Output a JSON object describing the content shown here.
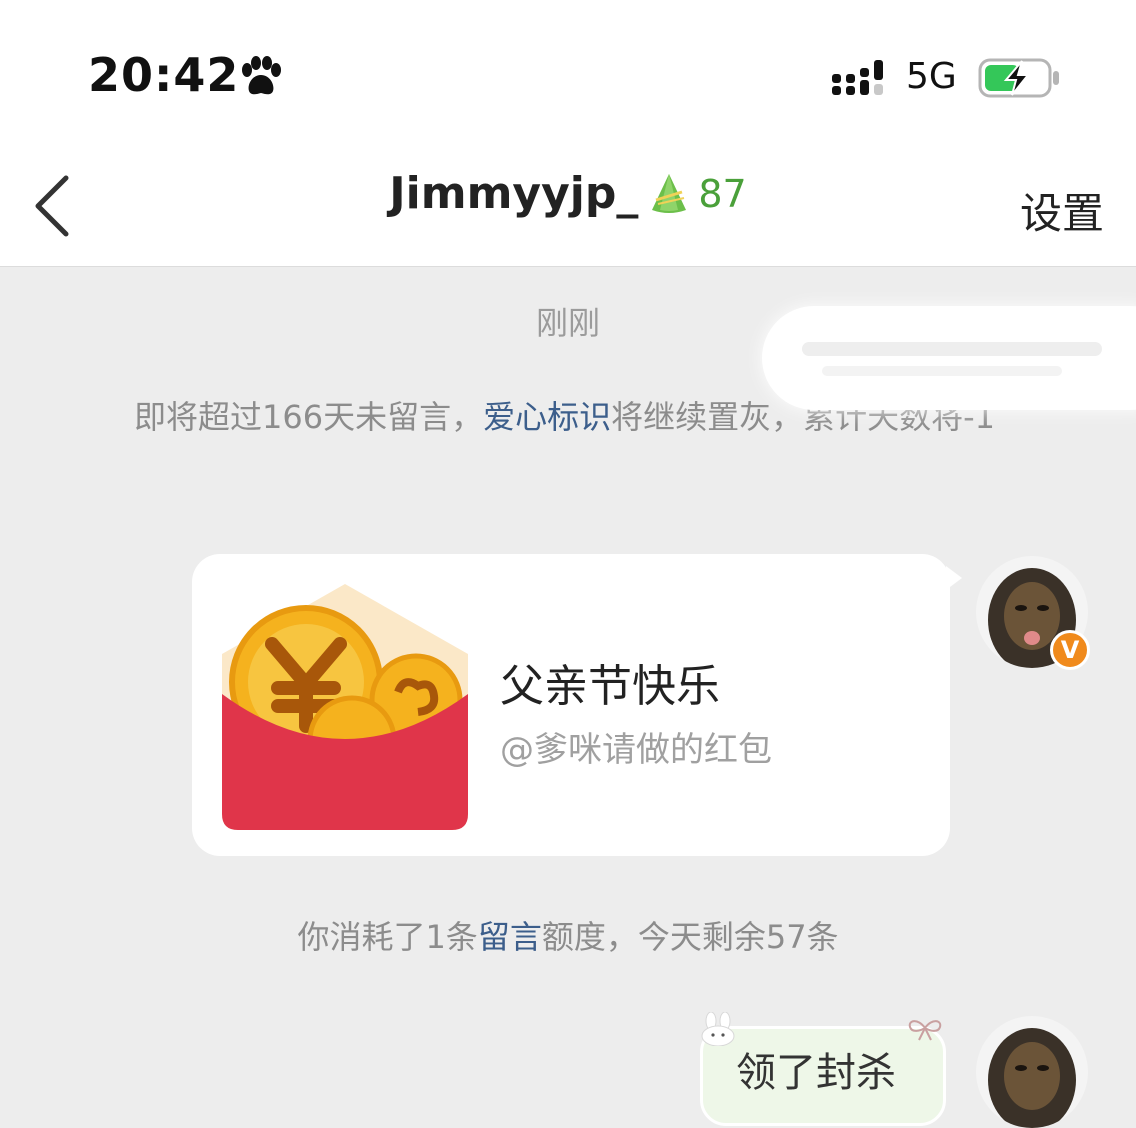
{
  "status_bar": {
    "time": "20:42",
    "network": "5G",
    "icons": [
      "paw-icon",
      "signal-icon",
      "battery-charging-icon"
    ],
    "battery_color": "#34c759"
  },
  "nav": {
    "back_icon": "chevron-left-icon",
    "title": "Jimmyyjp_",
    "level_icon": "zongzi-icon",
    "level": "87",
    "settings": "设置",
    "level_color": "#4aa03a"
  },
  "chat": {
    "timestamp": "刚刚",
    "notice": {
      "prefix": "即将超过166天未留言，",
      "link": "爱心标识",
      "suffix": "将继续置灰，累计天数将-1"
    },
    "red_packet": {
      "title": "父亲节快乐",
      "subtitle": "@爹咪请做的红包",
      "envelope_color": "#e0354a",
      "coin_color": "#f5b21e"
    },
    "avatar_badge": "V",
    "quota": {
      "prefix": "你消耗了1条",
      "link": "留言",
      "suffix": "额度，今天剩余57条"
    },
    "second_message": {
      "text": "领了封杀"
    },
    "link_color": "#3c5e8b"
  }
}
